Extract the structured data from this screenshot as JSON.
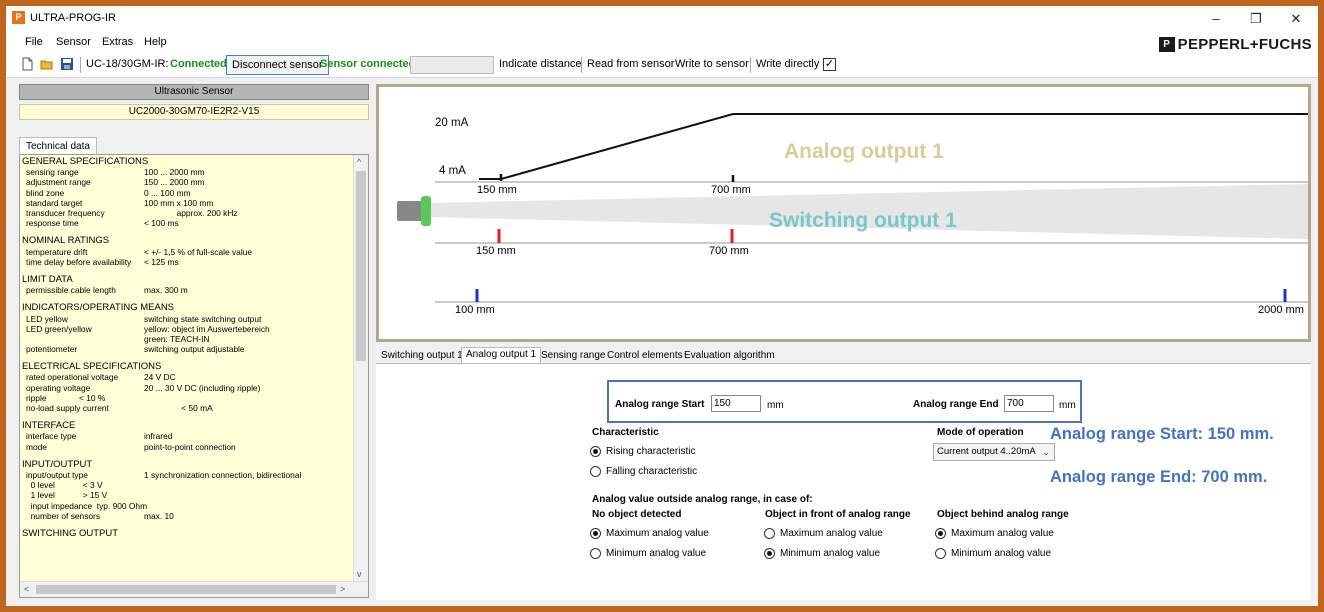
{
  "window": {
    "title": "ULTRA-PROG-IR",
    "app_icon": "pf-icon",
    "controls": [
      "–",
      "❐",
      "✕"
    ]
  },
  "menu": {
    "items": [
      "File",
      "Sensor",
      "Extras",
      "Help"
    ],
    "logo_mark": "P",
    "logo_text": "PEPPERL+FUCHS"
  },
  "toolbar": {
    "sensor_id": "UC-18/30GM-IR:",
    "connected": "Connected",
    "disconnect": "Disconnect sensor",
    "sensor_connected": "Sensor connected",
    "indicate_distance": "Indicate distance",
    "read_from_sensor": "Read from sensor",
    "write_to_sensor": "Write to sensor",
    "write_directly": "Write directly",
    "write_directly_checked": true
  },
  "left_panel": {
    "header": "Ultrasonic Sensor",
    "model": "UC2000-30GM70-IE2R2-V15",
    "tab": "Technical data",
    "sections": [
      {
        "title": "GENERAL SPECIFICATIONS",
        "rows": [
          {
            "k": "sensing range",
            "v": "100 ... 2000 mm"
          },
          {
            "k": "adjustment range",
            "v": "150 ... 2000 mm"
          },
          {
            "k": "blind zone",
            "v": "0 ... 100 mm"
          },
          {
            "k": "standard target",
            "v": "100 mm x 100 mm"
          },
          {
            "k": "transducer frequency",
            "v": "              approx. 200 kHz"
          },
          {
            "k": "response time",
            "v": "< 100 ms"
          }
        ]
      },
      {
        "title": "NOMINAL RATINGS",
        "rows": [
          {
            "k": "temperature drift",
            "v": "< +/- 1,5 % of full-scale value"
          },
          {
            "k": "time delay before availability",
            "v": "< 125 ms"
          }
        ]
      },
      {
        "title": "LIMIT DATA",
        "rows": [
          {
            "k": "permissible cable length",
            "v": "max. 300 m"
          }
        ]
      },
      {
        "title": "INDICATORS/OPERATING MEANS",
        "rows": [
          {
            "k": "LED yellow",
            "v": "switching state switching output"
          },
          {
            "k": "LED green/yellow",
            "v": "yellow: object im Auswertebereich"
          },
          {
            "k": "",
            "v": "green: TEACH-IN"
          },
          {
            "k": "potentiometer",
            "v": "switching output adjustable"
          }
        ]
      },
      {
        "title": "ELECTRICAL SPECIFICATIONS",
        "rows": [
          {
            "k": "rated operational voltage",
            "v": "24 V DC"
          },
          {
            "k": "operating voltage",
            "v": "20 ... 30 V DC (including ripple)"
          },
          {
            "k": "ripple              < 10 %",
            "v": ""
          },
          {
            "k": "no-load supply current",
            "v": "                < 50 mA"
          }
        ]
      },
      {
        "title": "INTERFACE",
        "rows": [
          {
            "k": "interface type",
            "v": "infrared"
          },
          {
            "k": "mode",
            "v": "point-to-point connection"
          }
        ]
      },
      {
        "title": "INPUT/OUTPUT",
        "rows": [
          {
            "k": "input/output type",
            "v": "1 synchronization connection, bidirectional"
          },
          {
            "k": "  0 level            < 3 V",
            "v": ""
          },
          {
            "k": "  1 level            > 15 V",
            "v": ""
          },
          {
            "k": "  input impedance  typ. 900 Ohm",
            "v": ""
          },
          {
            "k": "  number of sensors",
            "v": "max. 10"
          }
        ]
      },
      {
        "title": "SWITCHING OUTPUT",
        "rows": []
      }
    ]
  },
  "diagram": {
    "current_high": "20 mA",
    "current_low": "4 mA",
    "analog_title": "Analog output 1",
    "switching_title": "Switching output 1",
    "analog_start_label": "150 mm",
    "analog_end_label": "700 mm",
    "switch_start_label": "150 mm",
    "switch_end_label": "700 mm",
    "range_min_label": "100 mm",
    "range_max_label": "2000 mm"
  },
  "tabs": [
    "Switching output 1",
    "Analog output 1",
    "Sensing range",
    "Control elements",
    "Evaluation algorithm"
  ],
  "active_tab": "Analog output 1",
  "analog": {
    "start_label": "Analog range Start",
    "start_value": "150",
    "end_label": "Analog range End",
    "end_value": "700",
    "unit": "mm",
    "characteristic_label": "Characteristic",
    "rising": "Rising characteristic",
    "falling": "Falling characteristic",
    "mode_label": "Mode of operation",
    "mode_value": "Current output 4..20mA",
    "outside_label": "Analog value outside analog range, in case of:",
    "col1": "No object detected",
    "col2": "Object in front of analog range",
    "col3": "Object behind analog range",
    "max": "Maximum analog value",
    "min": "Minimum analog value"
  },
  "annotations": {
    "start": "Analog range Start: 150 mm.",
    "end": "Analog range End: 700 mm."
  }
}
